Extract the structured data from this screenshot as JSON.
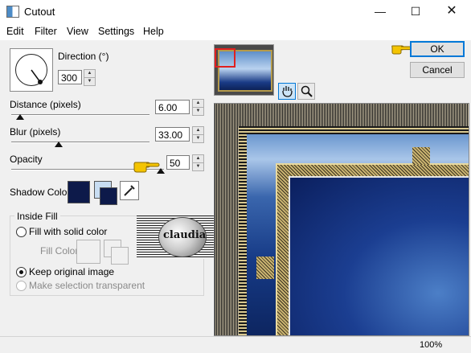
{
  "window": {
    "title": "Cutout",
    "minimize_icon": "minimize-icon",
    "maximize_icon": "maximize-icon",
    "close_icon": "close-icon"
  },
  "menu": [
    "Edit",
    "Filter",
    "View",
    "Settings",
    "Help"
  ],
  "direction": {
    "label": "Direction (°)",
    "value": "300"
  },
  "distance": {
    "label": "Distance (pixels)",
    "value": "6.00"
  },
  "blur": {
    "label": "Blur (pixels)",
    "value": "33.00"
  },
  "opacity": {
    "label": "Opacity",
    "value": "50"
  },
  "shadow_color": {
    "label": "Shadow Color",
    "color": "#0d1a4a",
    "secondary": "#c8ddf2"
  },
  "inside_fill": {
    "title": "Inside Fill",
    "fill_with_solid": "Fill with solid color",
    "fill_color_label": "Fill Color",
    "keep_original": "Keep original image",
    "make_transparent": "Make selection transparent"
  },
  "watermark_text": "claudia",
  "buttons": {
    "ok": "OK",
    "cancel": "Cancel"
  },
  "status": {
    "zoom": "100%"
  },
  "colors": {
    "accent": "#0078d7",
    "pointer_hand": "#f4c400"
  }
}
